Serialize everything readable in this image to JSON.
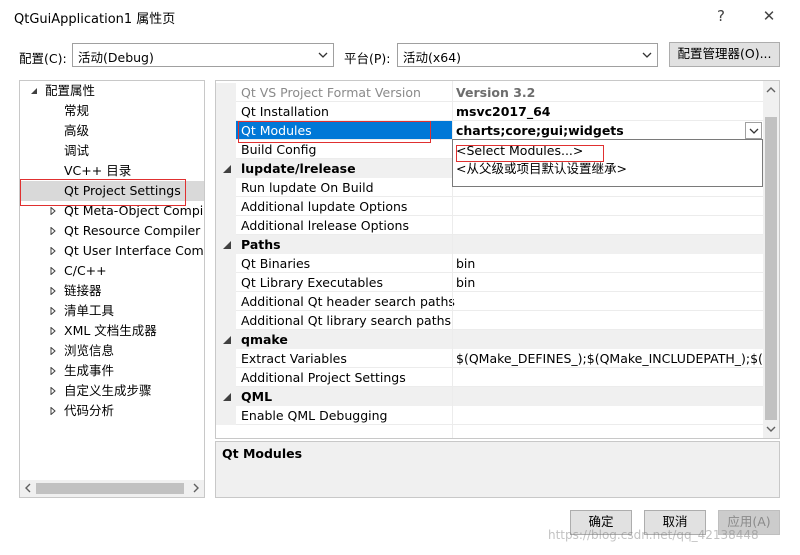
{
  "window": {
    "title": "QtGuiApplication1 属性页",
    "help_label": "?",
    "close_label": "✕"
  },
  "toolbar": {
    "config_label": "配置(C):",
    "config_value": "活动(Debug)",
    "platform_label": "平台(P):",
    "platform_value": "活动(x64)",
    "config_manager_label": "配置管理器(O)..."
  },
  "tree": {
    "root_label": "配置属性",
    "items": [
      {
        "label": "常规",
        "expandable": false
      },
      {
        "label": "高级",
        "expandable": false
      },
      {
        "label": "调试",
        "expandable": false
      },
      {
        "label": "VC++ 目录",
        "expandable": false
      },
      {
        "label": "Qt Project Settings",
        "expandable": false,
        "selected": true
      },
      {
        "label": "Qt Meta-Object Compiler",
        "expandable": true
      },
      {
        "label": "Qt Resource Compiler",
        "expandable": true
      },
      {
        "label": "Qt User Interface Compiler",
        "expandable": true
      },
      {
        "label": "C/C++",
        "expandable": true
      },
      {
        "label": "链接器",
        "expandable": true
      },
      {
        "label": "清单工具",
        "expandable": true
      },
      {
        "label": "XML 文档生成器",
        "expandable": true
      },
      {
        "label": "浏览信息",
        "expandable": true
      },
      {
        "label": "生成事件",
        "expandable": true
      },
      {
        "label": "自定义生成步骤",
        "expandable": true
      },
      {
        "label": "代码分析",
        "expandable": true
      }
    ]
  },
  "grid": {
    "rows": [
      {
        "kind": "prop",
        "name": "Qt VS Project Format Version",
        "value": "Version 3.2",
        "bold": true,
        "greyed": true
      },
      {
        "kind": "prop",
        "name": "Qt Installation",
        "value": "msvc2017_64",
        "bold": true
      },
      {
        "kind": "prop",
        "name": "Qt Modules",
        "value": "charts;core;gui;widgets",
        "bold": true,
        "selected": true
      },
      {
        "kind": "prop",
        "name": "Build Config",
        "value": ""
      },
      {
        "kind": "cat",
        "name": "lupdate/lrelease"
      },
      {
        "kind": "prop",
        "name": "Run lupdate On Build",
        "value": ""
      },
      {
        "kind": "prop",
        "name": "Additional lupdate Options",
        "value": ""
      },
      {
        "kind": "prop",
        "name": "Additional lrelease Options",
        "value": ""
      },
      {
        "kind": "cat",
        "name": "Paths"
      },
      {
        "kind": "prop",
        "name": "Qt Binaries",
        "value": "bin"
      },
      {
        "kind": "prop",
        "name": "Qt Library Executables",
        "value": "bin"
      },
      {
        "kind": "prop",
        "name": "Additional Qt header search paths",
        "value": ""
      },
      {
        "kind": "prop",
        "name": "Additional Qt library search paths",
        "value": ""
      },
      {
        "kind": "cat",
        "name": "qmake"
      },
      {
        "kind": "prop",
        "name": "Extract Variables",
        "value": "$(QMake_DEFINES_);$(QMake_INCLUDEPATH_);$(QMake_"
      },
      {
        "kind": "prop",
        "name": "Additional Project Settings",
        "value": ""
      },
      {
        "kind": "cat",
        "name": "QML"
      },
      {
        "kind": "prop",
        "name": "Enable QML Debugging",
        "value": ""
      }
    ]
  },
  "dropdown": {
    "options": [
      "<Select Modules...>",
      "<从父级或项目默认设置继承>"
    ]
  },
  "description": {
    "title": "Qt Modules"
  },
  "buttons": {
    "ok": "确定",
    "cancel": "取消",
    "apply": "应用(A)"
  },
  "watermark": "https://blog.csdn.net/qq_42138448",
  "colors": {
    "selection": "#0078d7",
    "red_highlight": "#e03030"
  }
}
